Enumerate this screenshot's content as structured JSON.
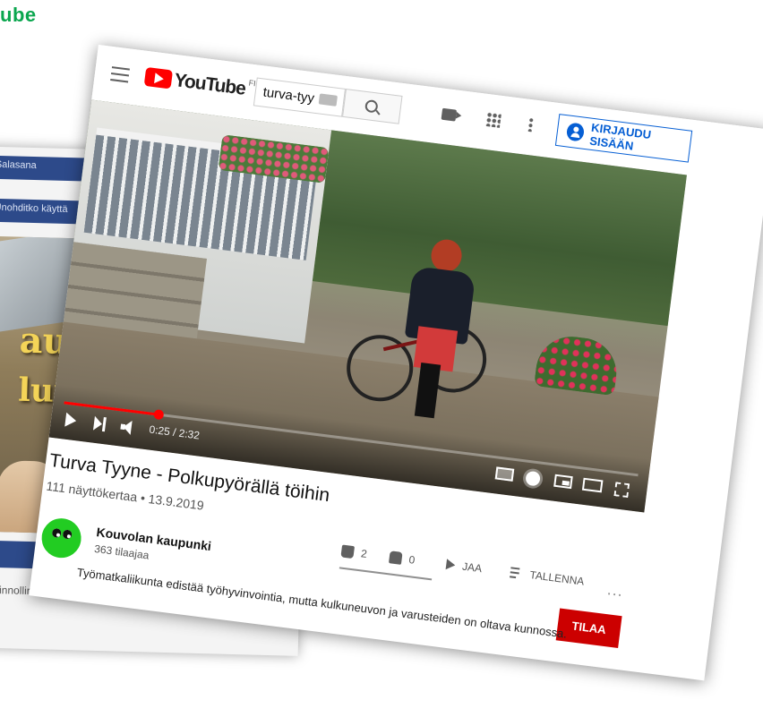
{
  "corner_label": "ube",
  "back_card": {
    "field1": "Salasana",
    "field2": "Unohditko käyttä",
    "poster_line1": "aupu",
    "poster_line2": "lutii",
    "footer_text": "shallinnollinen"
  },
  "topbar": {
    "logo_text": "YouTube",
    "region": "FI",
    "search_value": "turva-tyy",
    "signin_label": "KIRJAUDU SISÄÄN"
  },
  "player": {
    "time": "0:25 / 2:32",
    "progress_fraction": 0.164
  },
  "video": {
    "title": "Turva Tyyne - Polkupyörällä töihin",
    "meta": "111 näyttökertaa • 13.9.2019"
  },
  "channel": {
    "name": "Kouvolan kaupunki",
    "subscribers": "363 tilaajaa",
    "subscribe_label": "TILAA"
  },
  "actions": {
    "likes": "2",
    "dislikes": "0",
    "share_label": "JAA",
    "save_label": "TALLENNA",
    "more": "..."
  },
  "description": "Työmatkaliikunta edistää työhyvinvointia, mutta kulkuneuvon ja varusteiden on oltava kunnossa.",
  "colors": {
    "brand_red": "#ff0000",
    "signin_blue": "#065fd4",
    "subscribe_red": "#cc0000",
    "avatar_green": "#22cc22"
  }
}
